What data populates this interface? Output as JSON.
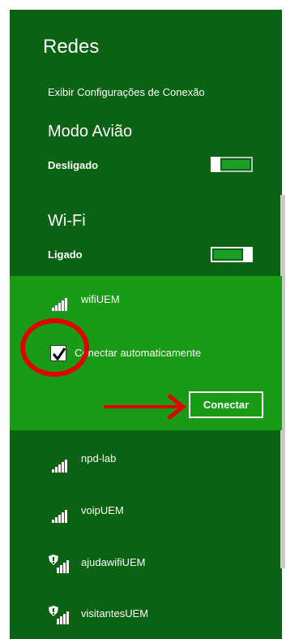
{
  "panel": {
    "title": "Redes",
    "connection_settings_link": "Exibir Configurações de Conexão"
  },
  "airplane_mode": {
    "title": "Modo Avião",
    "status": "Desligado",
    "on": false
  },
  "wifi": {
    "title": "Wi-Fi",
    "status": "Ligado",
    "on": true
  },
  "selected_network": {
    "name": "wifiUEM",
    "auto_connect_label": "Conectar automaticamente",
    "auto_connect_checked": true,
    "connect_button_label": "Conectar"
  },
  "networks": [
    {
      "name": "npd-lab",
      "secured": false
    },
    {
      "name": "voipUEM",
      "secured": false
    },
    {
      "name": "ajudawifiUEM",
      "secured": true
    },
    {
      "name": "visitantesUEM",
      "secured": true
    }
  ],
  "colors": {
    "panel_bg": "#0a6312",
    "selected_bg": "#1a9b17",
    "annotation_red": "#e00000"
  },
  "icons": {
    "signal": "wifi-signal-icon",
    "warning_shield": "security-warning-icon",
    "check": "checkmark-icon"
  }
}
